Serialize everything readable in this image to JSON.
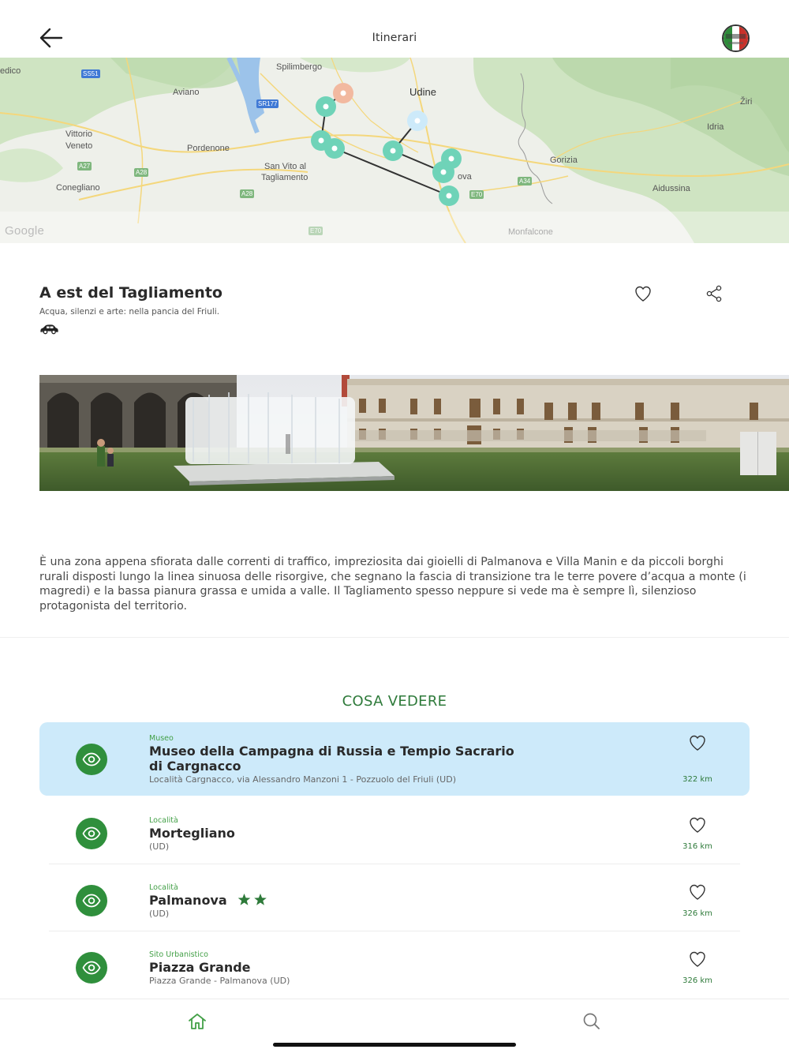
{
  "header": {
    "title": "Itinerari",
    "back_icon": "arrow-left-icon",
    "language_icon": "italian-flag-icon"
  },
  "map": {
    "labels": {
      "edico": "edico",
      "spilimbergo": "Spilimbergo",
      "aviano": "Aviano",
      "udine": "Udine",
      "ziri": "Žiri",
      "idria": "Idria",
      "vittorio": "Vittorio",
      "veneto": "Veneto",
      "pordenone": "Pordenone",
      "sanvito1": "San Vito al",
      "sanvito2": "Tagliamento",
      "gorizia": "Gorizia",
      "conegliano": "Conegliano",
      "aidussina": "Aidussina",
      "monfalcone": "Monfalcone",
      "palmanova_partial": "ova"
    },
    "roads": {
      "ss51": "SS51",
      "sr177": "SR177",
      "a27": "A27",
      "a28a": "A28",
      "a28b": "A28",
      "a34": "A34",
      "e70a": "E70",
      "e70b": "E70"
    },
    "attribution": "Google"
  },
  "route": {
    "title": "A est del Tagliamento",
    "subtitle": "Acqua, silenzi e arte: nella pancia del Friuli.",
    "transport_icon": "car-icon",
    "description": "È una zona appena sfiorata dalle correnti di traffico, impreziosita dai gioielli di Palmanova e Villa Manin e da piccoli borghi rurali disposti lungo la linea sinuosa delle risorgive, che segnano la fascia di transizione tra le terre povere d’acqua a monte (i magredi) e la bassa pianura grassa e umida a valle. Il Tagliamento spesso neppure si vede ma è sempre lì, silenzioso protagonista del territorio."
  },
  "section": {
    "title": "COSA VEDERE"
  },
  "pois": [
    {
      "category": "Museo",
      "name": "Museo della Campagna di Russia e Tempio Sacrario di Cargnacco",
      "address": "Località Cargnacco, via Alessandro Manzoni 1 - Pozzuolo del Friuli (UD)",
      "distance": "322 km",
      "stars": 0,
      "highlighted": true
    },
    {
      "category": "Località",
      "name": "Mortegliano",
      "address": "(UD)",
      "distance": "316 km",
      "stars": 0,
      "highlighted": false
    },
    {
      "category": "Località",
      "name": "Palmanova",
      "address": "(UD)",
      "distance": "326 km",
      "stars": 2,
      "highlighted": false
    },
    {
      "category": "Sito Urbanistico",
      "name": "Piazza Grande",
      "address": "Piazza Grande - Palmanova (UD)",
      "distance": "326 km",
      "stars": 0,
      "highlighted": false
    }
  ],
  "tabbar": {
    "home_icon": "home-icon",
    "search_icon": "search-icon"
  },
  "colors": {
    "accent_green": "#2f8f3c",
    "highlight_blue": "#cdeafa",
    "marker_teal": "#6fd3b8",
    "marker_orange": "#f2b9a0",
    "marker_lightblue": "#cdeafa"
  }
}
